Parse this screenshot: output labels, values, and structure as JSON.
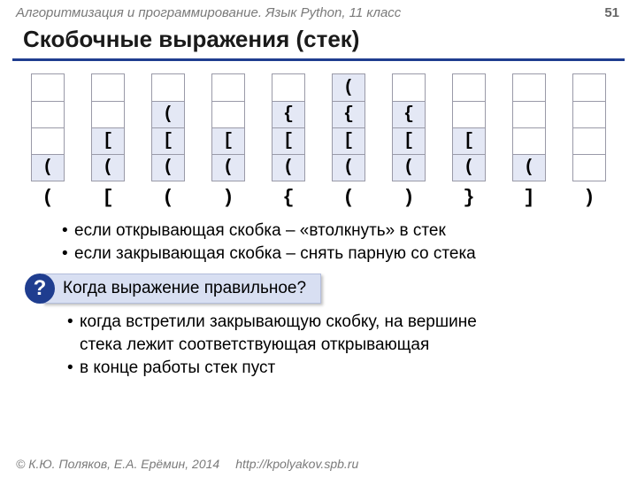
{
  "header": {
    "course": "Алгоритмизация и программирование. Язык Python, 11 класс",
    "page": "51"
  },
  "title": "Скобочные выражения (стек)",
  "stacks": [
    {
      "cells": [
        "",
        "",
        "",
        "("
      ],
      "input": "("
    },
    {
      "cells": [
        "",
        "",
        "[",
        "("
      ],
      "input": "["
    },
    {
      "cells": [
        "",
        "(",
        "[",
        "("
      ],
      "input": "("
    },
    {
      "cells": [
        "",
        "",
        "[",
        "("
      ],
      "input": ")"
    },
    {
      "cells": [
        "",
        "{",
        "[",
        "("
      ],
      "input": "{"
    },
    {
      "cells": [
        "(",
        "{",
        "[",
        "("
      ],
      "input": "("
    },
    {
      "cells": [
        "",
        "{",
        "[",
        "("
      ],
      "input": ")"
    },
    {
      "cells": [
        "",
        "",
        "[",
        "("
      ],
      "input": "}"
    },
    {
      "cells": [
        "",
        "",
        "",
        "("
      ],
      "input": "]"
    },
    {
      "cells": [
        "",
        "",
        "",
        ""
      ],
      "input": ")"
    }
  ],
  "rules": {
    "r1": "если открывающая скобка – «втолкнуть» в стек",
    "r2": "если закрывающая скобка – снять парную со стека"
  },
  "question": {
    "mark": "?",
    "text": "Когда выражение правильное?"
  },
  "answers": {
    "a1a": "когда встретили закрывающую скобку, на вершине",
    "a1b": "стека лежит соответствующая открывающая",
    "a2": "в конце работы стек пуст"
  },
  "footer": {
    "copyright": "© К.Ю. Поляков, Е.А. Ерёмин, 2014",
    "url": "http://kpolyakov.spb.ru"
  }
}
